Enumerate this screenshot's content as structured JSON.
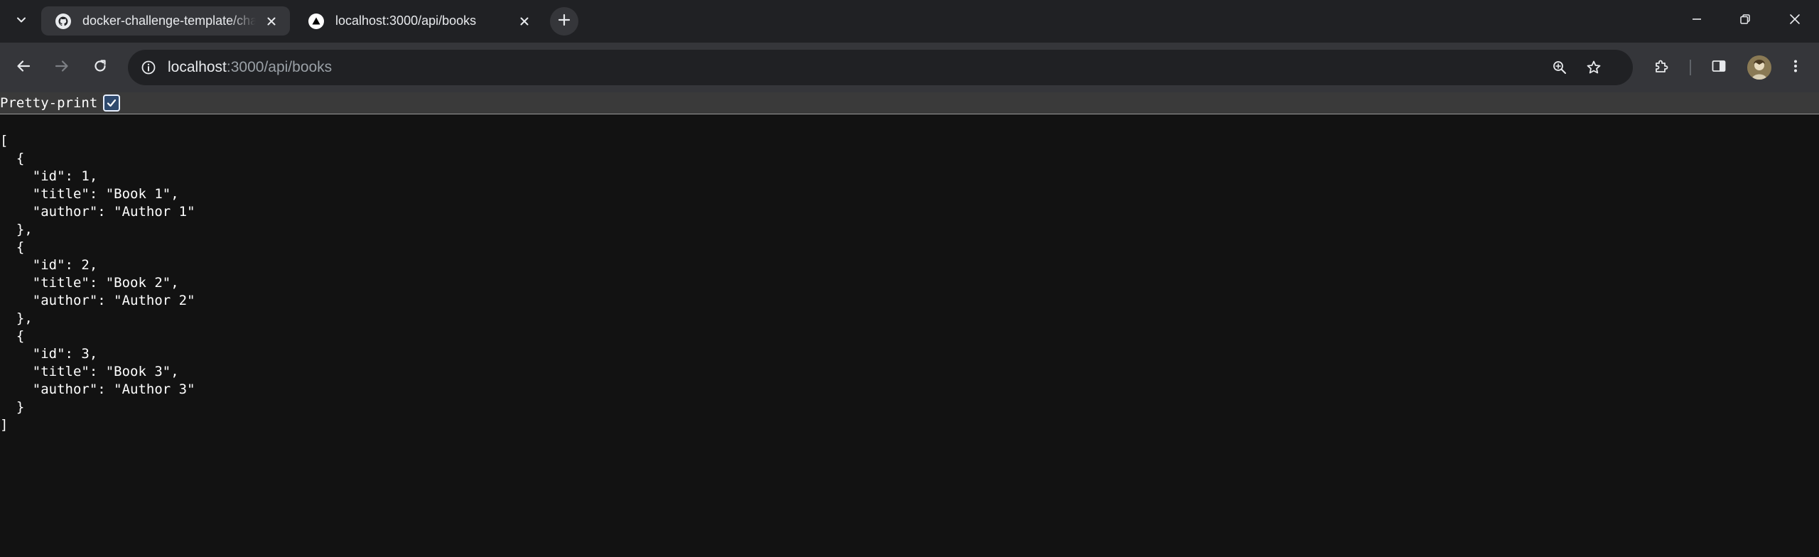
{
  "tabs": [
    {
      "title": "docker-challenge-template/cha",
      "favicon": "github-icon",
      "active": true
    },
    {
      "title": "localhost:3000/api/books",
      "favicon": "triangle-logo-icon",
      "active": false
    }
  ],
  "omnibox": {
    "host": "localhost",
    "path": ":3000/api/books"
  },
  "pretty_print": {
    "label": "Pretty-print",
    "checked": true
  },
  "json_lines": [
    "[",
    "  {",
    "    \"id\": 1,",
    "    \"title\": \"Book 1\",",
    "    \"author\": \"Author 1\"",
    "  },",
    "  {",
    "    \"id\": 2,",
    "    \"title\": \"Book 2\",",
    "    \"author\": \"Author 2\"",
    "  },",
    "  {",
    "    \"id\": 3,",
    "    \"title\": \"Book 3\",",
    "    \"author\": \"Author 3\"",
    "  }",
    "]"
  ],
  "colors": {
    "tabstrip": "#202124",
    "toolbar": "#35363a",
    "page_background": "#121212",
    "text": "#ffffff"
  }
}
